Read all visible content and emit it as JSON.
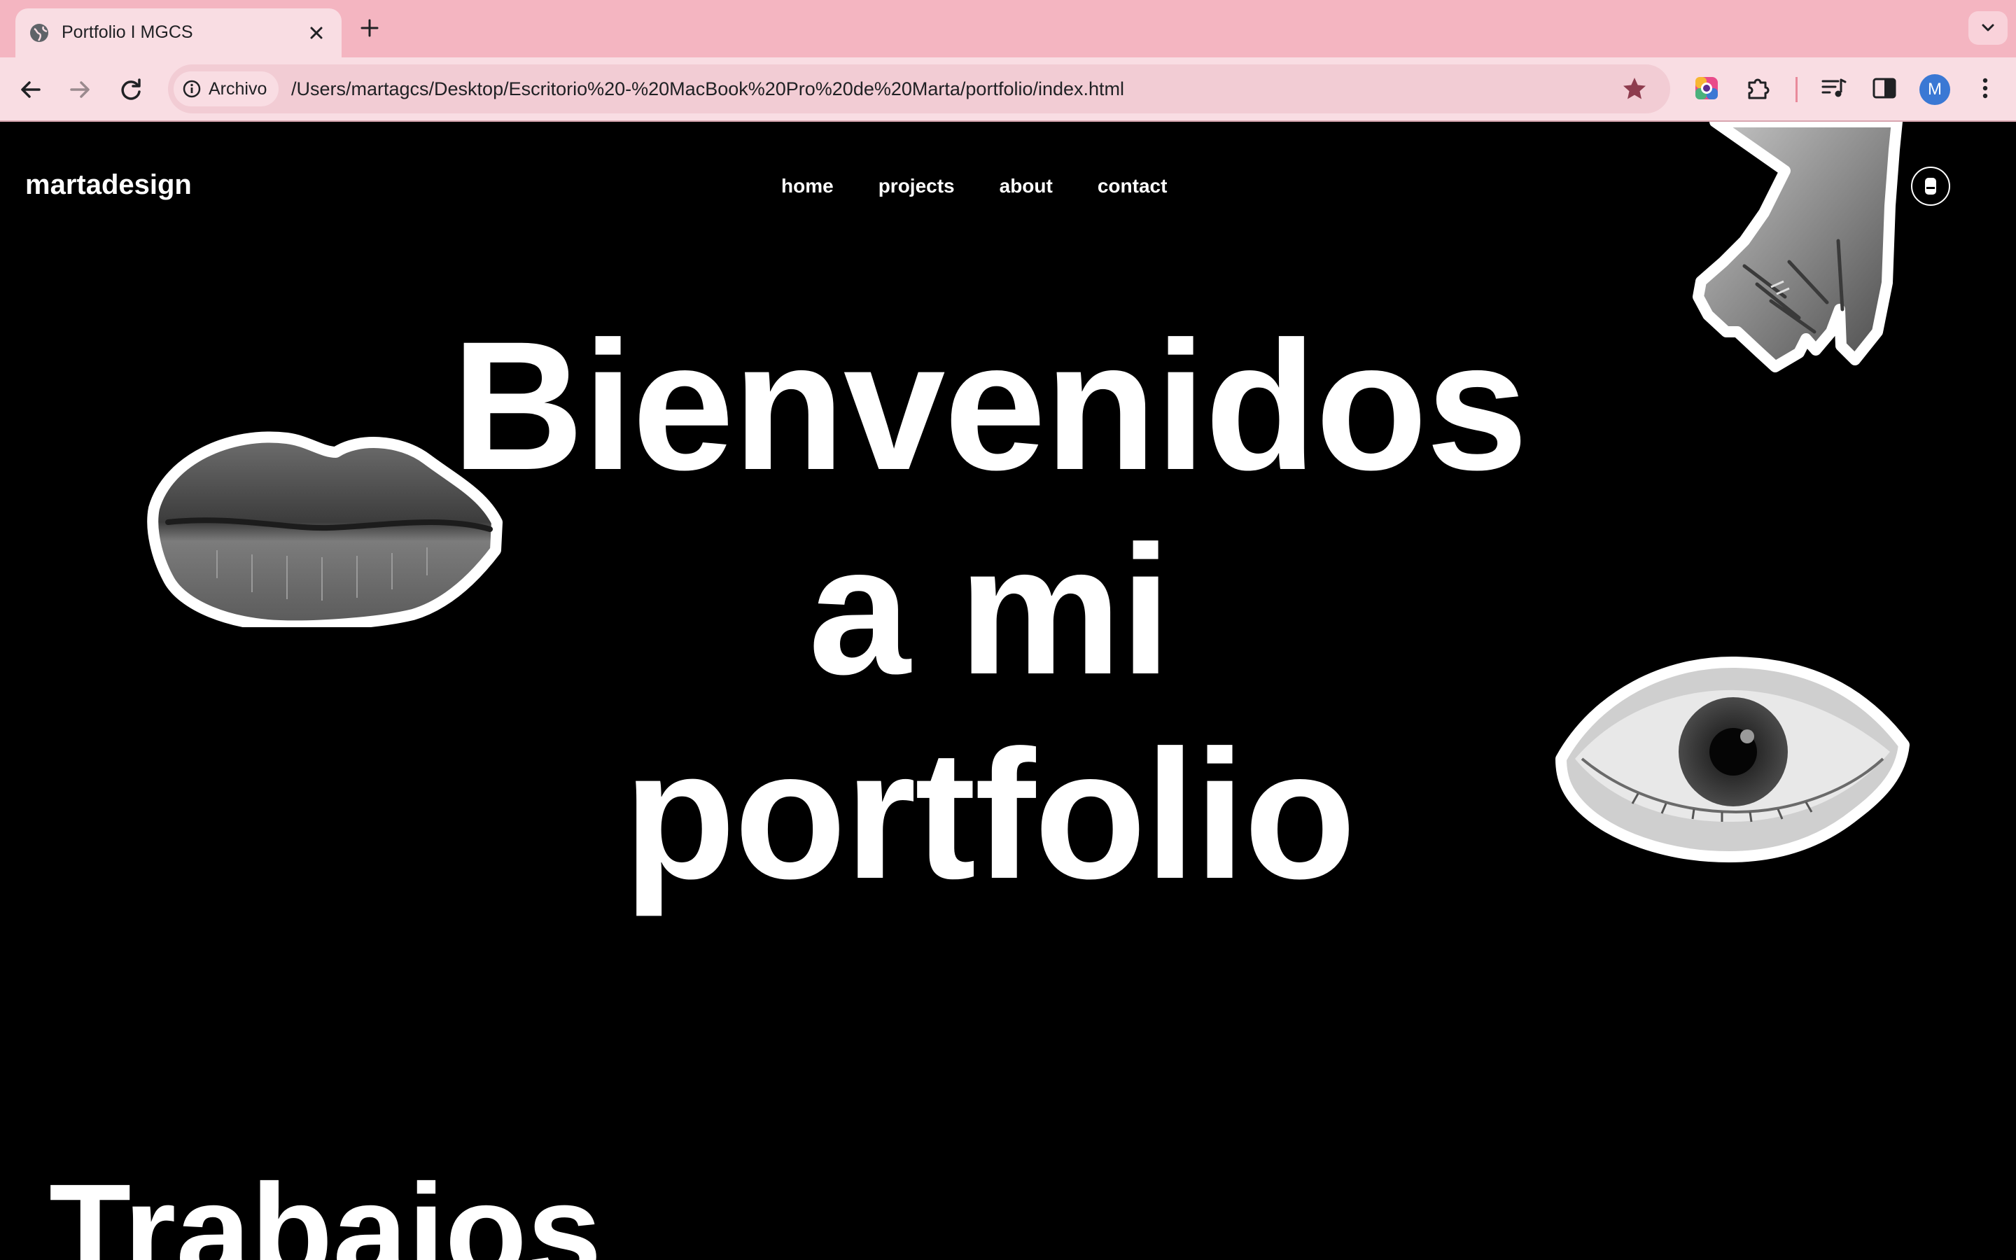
{
  "browser": {
    "tab": {
      "title": "Portfolio I MGCS",
      "icon": "globe-icon"
    },
    "address_bar": {
      "site_label": "Archivo",
      "url": "/Users/martagcs/Desktop/Escritorio%20-%20MacBook%20Pro%20de%20Marta/portfolio/index.html"
    },
    "profile_initial": "M",
    "colors": {
      "frame": "#f4b5c1",
      "toolbar": "#f9dde3",
      "omnibox": "#f2ccd4",
      "star": "#8e3c4e"
    }
  },
  "page": {
    "logo": "martadesign",
    "nav": [
      {
        "label": "home"
      },
      {
        "label": "projects"
      },
      {
        "label": "about"
      },
      {
        "label": "contact"
      }
    ],
    "hero": {
      "line1": "Bienvenidos",
      "line2": "a mi",
      "line3": "portfolio"
    },
    "section_title": "Trabajos",
    "colors": {
      "background": "#000000",
      "text": "#ffffff"
    }
  }
}
